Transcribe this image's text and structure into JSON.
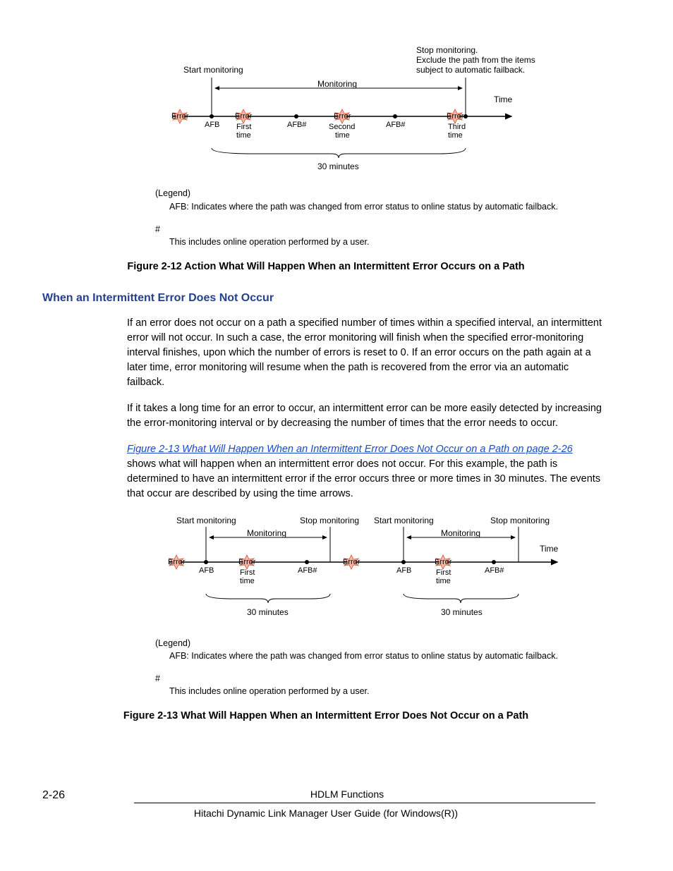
{
  "diagram1": {
    "stop_monitoring": "Stop monitoring.",
    "exclude": "Exclude the path from the  items",
    "subject": "subject to automatic failback.",
    "start_monitoring": "Start monitoring",
    "monitoring": "Monitoring",
    "time": "Time",
    "error": "Error",
    "afb": "AFB",
    "afb_hash": "AFB#",
    "first_time": "First\ntime",
    "second_time": "Second\ntime",
    "third_time": "Third\ntime",
    "duration": "30 minutes"
  },
  "legend1": {
    "legend_label": "(Legend)",
    "afb_desc": "AFB: Indicates where the path was changed from error status to online status by automatic failback.",
    "hash": "#",
    "hash_desc": "This includes online operation performed by a user."
  },
  "caption1": "Figure 2-12 Action What Will Happen When an Intermittent Error Occurs on a Path",
  "heading": "When an Intermittent Error Does Not Occur",
  "para1": "If an error does not occur on a path a specified number of times within a specified interval, an intermittent error will not occur. In such a case, the error monitoring will finish when the specified error-monitoring interval finishes, upon which the number of errors is reset to 0. If an error occurs on the path again at a later time, error monitoring will resume when the path is recovered from the error via an automatic failback.",
  "para2": "If it takes a long time for an error to occur, an intermittent error can be more easily detected by increasing the error-monitoring interval or by decreasing the number of times that the error needs to occur.",
  "para3_link": "Figure 2-13 What Will Happen When an Intermittent Error Does Not Occur on a Path on page 2-26",
  "para3_rest": " shows what will happen when an intermittent error does not occur. For this example, the path is determined to have an intermittent error if the error occurs three or more times in 30 minutes. The events that occur are described by using the time arrows.",
  "diagram2": {
    "start_monitoring": "Start monitoring",
    "stop_monitoring": "Stop monitoring",
    "monitoring": "Monitoring",
    "time": "Time",
    "error": "Error",
    "afb": "AFB",
    "afb_hash": "AFB#",
    "first_time": "First\ntime",
    "duration": "30 minutes"
  },
  "legend2": {
    "legend_label": "(Legend)",
    "afb_desc": "AFB: Indicates where the path was changed from error status to online status by automatic failback.",
    "hash": "#",
    "hash_desc": "This includes online operation performed by a user."
  },
  "caption2": "Figure 2-13 What Will Happen When an Intermittent Error Does Not Occur on a Path",
  "footer": {
    "page": "2-26",
    "title": "HDLM Functions",
    "sub": "Hitachi Dynamic Link Manager User Guide (for Windows(R))"
  }
}
